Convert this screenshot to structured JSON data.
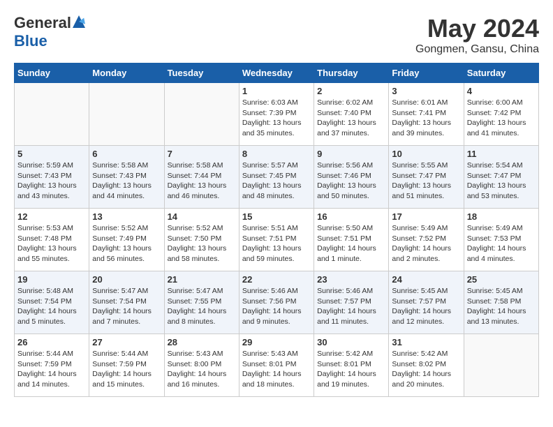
{
  "header": {
    "logo_general": "General",
    "logo_blue": "Blue",
    "month_year": "May 2024",
    "location": "Gongmen, Gansu, China"
  },
  "weekdays": [
    "Sunday",
    "Monday",
    "Tuesday",
    "Wednesday",
    "Thursday",
    "Friday",
    "Saturday"
  ],
  "weeks": [
    [
      {
        "day": "",
        "info": ""
      },
      {
        "day": "",
        "info": ""
      },
      {
        "day": "",
        "info": ""
      },
      {
        "day": "1",
        "info": "Sunrise: 6:03 AM\nSunset: 7:39 PM\nDaylight: 13 hours\nand 35 minutes."
      },
      {
        "day": "2",
        "info": "Sunrise: 6:02 AM\nSunset: 7:40 PM\nDaylight: 13 hours\nand 37 minutes."
      },
      {
        "day": "3",
        "info": "Sunrise: 6:01 AM\nSunset: 7:41 PM\nDaylight: 13 hours\nand 39 minutes."
      },
      {
        "day": "4",
        "info": "Sunrise: 6:00 AM\nSunset: 7:42 PM\nDaylight: 13 hours\nand 41 minutes."
      }
    ],
    [
      {
        "day": "5",
        "info": "Sunrise: 5:59 AM\nSunset: 7:43 PM\nDaylight: 13 hours\nand 43 minutes."
      },
      {
        "day": "6",
        "info": "Sunrise: 5:58 AM\nSunset: 7:43 PM\nDaylight: 13 hours\nand 44 minutes."
      },
      {
        "day": "7",
        "info": "Sunrise: 5:58 AM\nSunset: 7:44 PM\nDaylight: 13 hours\nand 46 minutes."
      },
      {
        "day": "8",
        "info": "Sunrise: 5:57 AM\nSunset: 7:45 PM\nDaylight: 13 hours\nand 48 minutes."
      },
      {
        "day": "9",
        "info": "Sunrise: 5:56 AM\nSunset: 7:46 PM\nDaylight: 13 hours\nand 50 minutes."
      },
      {
        "day": "10",
        "info": "Sunrise: 5:55 AM\nSunset: 7:47 PM\nDaylight: 13 hours\nand 51 minutes."
      },
      {
        "day": "11",
        "info": "Sunrise: 5:54 AM\nSunset: 7:47 PM\nDaylight: 13 hours\nand 53 minutes."
      }
    ],
    [
      {
        "day": "12",
        "info": "Sunrise: 5:53 AM\nSunset: 7:48 PM\nDaylight: 13 hours\nand 55 minutes."
      },
      {
        "day": "13",
        "info": "Sunrise: 5:52 AM\nSunset: 7:49 PM\nDaylight: 13 hours\nand 56 minutes."
      },
      {
        "day": "14",
        "info": "Sunrise: 5:52 AM\nSunset: 7:50 PM\nDaylight: 13 hours\nand 58 minutes."
      },
      {
        "day": "15",
        "info": "Sunrise: 5:51 AM\nSunset: 7:51 PM\nDaylight: 13 hours\nand 59 minutes."
      },
      {
        "day": "16",
        "info": "Sunrise: 5:50 AM\nSunset: 7:51 PM\nDaylight: 14 hours\nand 1 minute."
      },
      {
        "day": "17",
        "info": "Sunrise: 5:49 AM\nSunset: 7:52 PM\nDaylight: 14 hours\nand 2 minutes."
      },
      {
        "day": "18",
        "info": "Sunrise: 5:49 AM\nSunset: 7:53 PM\nDaylight: 14 hours\nand 4 minutes."
      }
    ],
    [
      {
        "day": "19",
        "info": "Sunrise: 5:48 AM\nSunset: 7:54 PM\nDaylight: 14 hours\nand 5 minutes."
      },
      {
        "day": "20",
        "info": "Sunrise: 5:47 AM\nSunset: 7:54 PM\nDaylight: 14 hours\nand 7 minutes."
      },
      {
        "day": "21",
        "info": "Sunrise: 5:47 AM\nSunset: 7:55 PM\nDaylight: 14 hours\nand 8 minutes."
      },
      {
        "day": "22",
        "info": "Sunrise: 5:46 AM\nSunset: 7:56 PM\nDaylight: 14 hours\nand 9 minutes."
      },
      {
        "day": "23",
        "info": "Sunrise: 5:46 AM\nSunset: 7:57 PM\nDaylight: 14 hours\nand 11 minutes."
      },
      {
        "day": "24",
        "info": "Sunrise: 5:45 AM\nSunset: 7:57 PM\nDaylight: 14 hours\nand 12 minutes."
      },
      {
        "day": "25",
        "info": "Sunrise: 5:45 AM\nSunset: 7:58 PM\nDaylight: 14 hours\nand 13 minutes."
      }
    ],
    [
      {
        "day": "26",
        "info": "Sunrise: 5:44 AM\nSunset: 7:59 PM\nDaylight: 14 hours\nand 14 minutes."
      },
      {
        "day": "27",
        "info": "Sunrise: 5:44 AM\nSunset: 7:59 PM\nDaylight: 14 hours\nand 15 minutes."
      },
      {
        "day": "28",
        "info": "Sunrise: 5:43 AM\nSunset: 8:00 PM\nDaylight: 14 hours\nand 16 minutes."
      },
      {
        "day": "29",
        "info": "Sunrise: 5:43 AM\nSunset: 8:01 PM\nDaylight: 14 hours\nand 18 minutes."
      },
      {
        "day": "30",
        "info": "Sunrise: 5:42 AM\nSunset: 8:01 PM\nDaylight: 14 hours\nand 19 minutes."
      },
      {
        "day": "31",
        "info": "Sunrise: 5:42 AM\nSunset: 8:02 PM\nDaylight: 14 hours\nand 20 minutes."
      },
      {
        "day": "",
        "info": ""
      }
    ]
  ]
}
